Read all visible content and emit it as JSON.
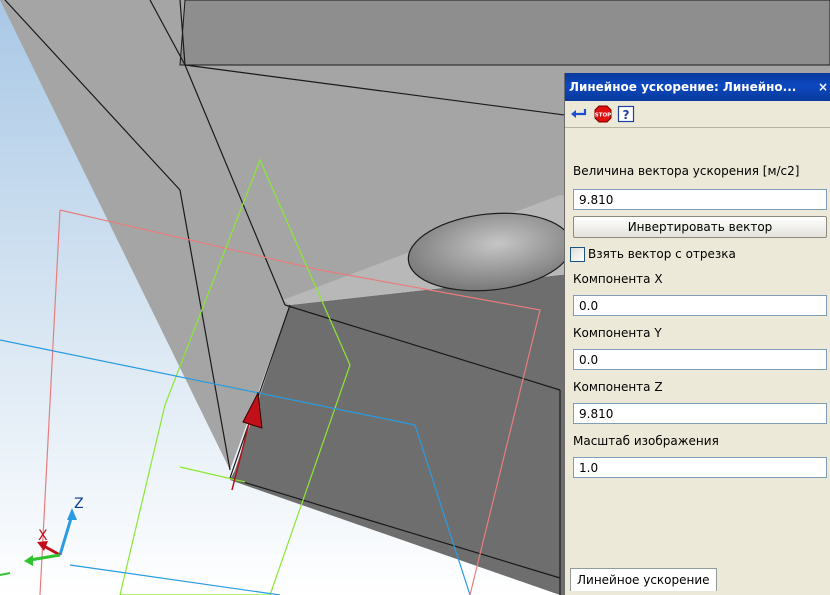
{
  "panel": {
    "title": "Линейное ускорение: Линейно...",
    "close": "×",
    "toolbar": [
      {
        "icon": "enter-arrow-icon"
      },
      {
        "icon": "stop-icon",
        "text": "STOP"
      },
      {
        "icon": "help-icon",
        "text": "?"
      }
    ],
    "magnitude_label": "Величина вектора ускорения [м/с2]",
    "magnitude_value": "9.810",
    "invert_label": "Инвертировать вектор",
    "take_vector_label": "Взять вектор с отрезка",
    "take_vector_checked": false,
    "comp_x_label": "Компонента X",
    "comp_x_value": "0.0",
    "comp_y_label": "Компонента Y",
    "comp_y_value": "0.0",
    "comp_z_label": "Компонента Z",
    "comp_z_value": "9.810",
    "scale_label": "Масштаб изображения",
    "scale_value": "1.0",
    "tab_label": "Линейное ускорение"
  },
  "axes": {
    "x": "X",
    "z": "Z"
  },
  "colors": {
    "title_bar": "#0a3a9b",
    "panel_bg": "#ece9d8",
    "plane_xz": "#e87d7d",
    "plane_yz": "#8ae832",
    "plane_xy": "#2a9be0",
    "vector": "#b0101a"
  }
}
